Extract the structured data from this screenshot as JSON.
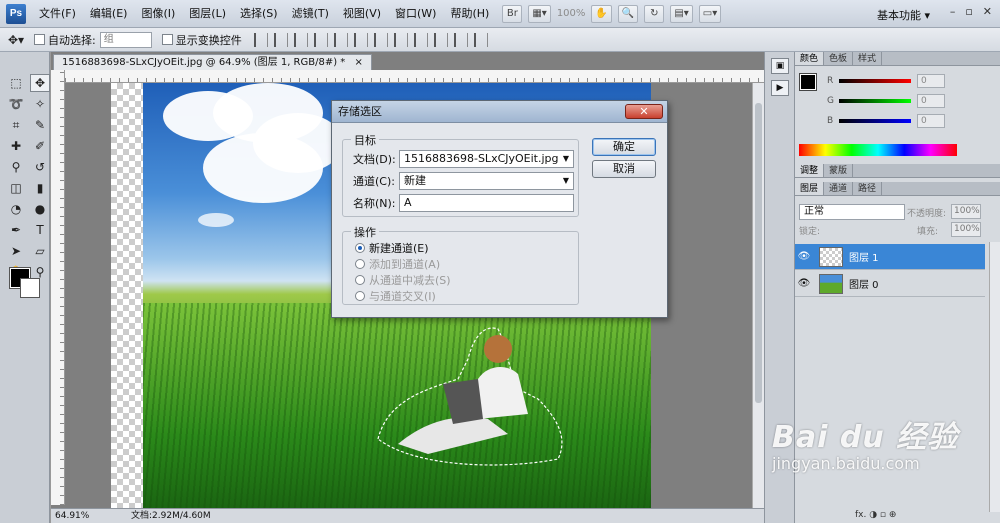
{
  "menubar": {
    "logo": "Ps",
    "items": [
      "文件(F)",
      "编辑(E)",
      "图像(I)",
      "图层(L)",
      "选择(S)",
      "滤镜(T)",
      "视图(V)",
      "窗口(W)",
      "帮助(H)"
    ],
    "zoom": "100%",
    "workspace": "基本功能",
    "window_controls": [
      "–",
      "▫",
      "✕"
    ]
  },
  "options": {
    "auto_select_label": "自动选择:",
    "auto_select_value": "组",
    "show_transform_label": "显示变换控件"
  },
  "document": {
    "tab_title": "1516883698-SLxCJyOEit.jpg @ 64.9% (图层 1, RGB/8#) *",
    "tab_close": "×",
    "status_zoom": "64.91%",
    "status_doc": "文档:2.92M/4.60M"
  },
  "dialog": {
    "title": "存储选区",
    "close": "✕",
    "target_legend": "目标",
    "doc_label": "文档(D):",
    "doc_value": "1516883698-SLxCJyOEit.jpg",
    "channel_label": "通道(C):",
    "channel_value": "新建",
    "name_label": "名称(N):",
    "name_value": "A",
    "op_legend": "操作",
    "ops": [
      "新建通道(E)",
      "添加到通道(A)",
      "从通道中减去(S)",
      "与通道交叉(I)"
    ],
    "ok": "确定",
    "cancel": "取消"
  },
  "color_panel": {
    "tabs": [
      "颜色",
      "色板",
      "样式"
    ],
    "channels": [
      {
        "label": "R",
        "value": "0",
        "color": "#d42020"
      },
      {
        "label": "G",
        "value": "0",
        "color": "#20b020"
      },
      {
        "label": "B",
        "value": "0",
        "color": "#2030c8"
      }
    ]
  },
  "adjust_tabs": [
    "调整",
    "蒙版"
  ],
  "layers_panel": {
    "tabs": [
      "图层",
      "通道",
      "路径"
    ],
    "blend_mode": "正常",
    "opacity_label": "不透明度:",
    "opacity_value": "100%",
    "lock_label": "锁定:",
    "fill_label": "填充:",
    "fill_value": "100%",
    "layers": [
      {
        "name": "图层 1",
        "selected": true
      },
      {
        "name": "图层 0",
        "selected": false
      }
    ],
    "footer": "fx. ◑ ▫ ⊕"
  },
  "watermark": {
    "main": "Bai du 经验",
    "sub": "jingyan.baidu.com"
  }
}
